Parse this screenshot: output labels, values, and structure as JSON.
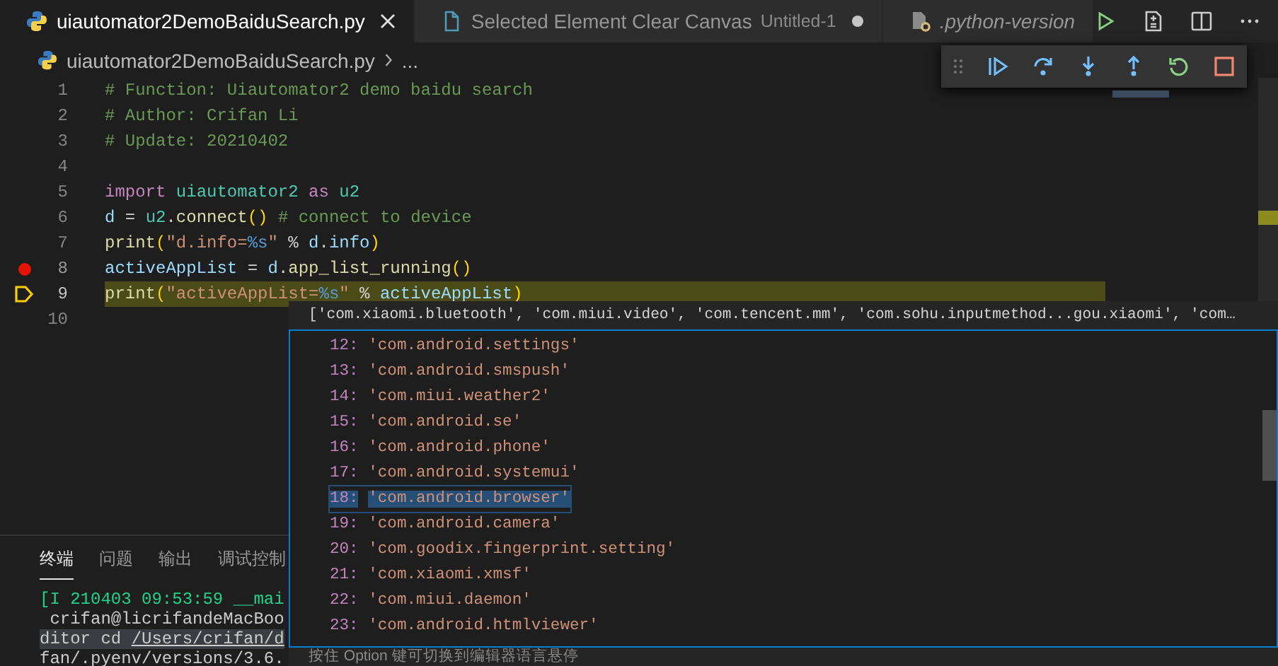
{
  "editor_tabs": [
    {
      "label": "uiautomator2DemoBaiduSearch.py",
      "selected": true,
      "dirty": false,
      "preview": false
    },
    {
      "label": "Selected Element Clear Canvas",
      "description": "Untitled-1",
      "selected": false,
      "dirty": true,
      "preview": false
    },
    {
      "label": ".python-version",
      "selected": false,
      "dirty": false,
      "preview": true
    }
  ],
  "breadcrumb": {
    "file": "uiautomator2DemoBaiduSearch.py",
    "more": "..."
  },
  "code_lines": [
    {
      "number": "1",
      "breakpoint": false,
      "current": false,
      "tokens": [
        {
          "text": "# Function: Uiautomator2 demo baidu search",
          "kind": "comment"
        }
      ]
    },
    {
      "number": "2",
      "breakpoint": false,
      "current": false,
      "tokens": [
        {
          "text": "# Author: Crifan Li",
          "kind": "comment"
        }
      ]
    },
    {
      "number": "3",
      "breakpoint": false,
      "current": false,
      "tokens": [
        {
          "text": "# Update: 20210402",
          "kind": "comment"
        }
      ]
    },
    {
      "number": "4",
      "breakpoint": false,
      "current": false
    },
    {
      "number": "5",
      "breakpoint": false,
      "current": false,
      "tokens": [
        {
          "text": "import ",
          "kind": "keyword"
        },
        {
          "text": "uiautomator2 ",
          "kind": "module"
        },
        {
          "text": "as ",
          "kind": "keyword"
        },
        {
          "text": "u2",
          "kind": "module"
        }
      ]
    },
    {
      "number": "6",
      "breakpoint": false,
      "current": false,
      "tokens": [
        {
          "text": "d",
          "kind": "variable"
        },
        {
          "text": " = ",
          "kind": "plain"
        },
        {
          "text": "u2",
          "kind": "module"
        },
        {
          "text": ".",
          "kind": "plain"
        },
        {
          "text": "connect",
          "kind": "function"
        },
        {
          "text": "()",
          "kind": "paren"
        },
        {
          "text": " # connect to device",
          "kind": "comment"
        }
      ]
    },
    {
      "number": "7",
      "breakpoint": false,
      "current": false,
      "tokens": [
        {
          "text": "print",
          "kind": "function"
        },
        {
          "text": "(",
          "kind": "paren"
        },
        {
          "text": "\"d.info=",
          "kind": "string"
        },
        {
          "text": "%s",
          "kind": "format"
        },
        {
          "text": "\"",
          "kind": "string"
        },
        {
          "text": " % ",
          "kind": "plain"
        },
        {
          "text": "d",
          "kind": "variable"
        },
        {
          "text": ".",
          "kind": "plain"
        },
        {
          "text": "info",
          "kind": "variable"
        },
        {
          "text": ")",
          "kind": "paren"
        }
      ]
    },
    {
      "number": "8",
      "breakpoint": true,
      "current": false,
      "tokens": [
        {
          "text": "activeAppList",
          "kind": "variable"
        },
        {
          "text": " = ",
          "kind": "plain"
        },
        {
          "text": "d",
          "kind": "variable"
        },
        {
          "text": ".",
          "kind": "plain"
        },
        {
          "text": "app_list_running",
          "kind": "function"
        },
        {
          "text": "()",
          "kind": "paren"
        }
      ]
    },
    {
      "number": "9",
      "breakpoint": false,
      "current": true,
      "tokens": [
        {
          "text": "print",
          "kind": "function"
        },
        {
          "text": "(",
          "kind": "paren"
        },
        {
          "text": "\"activeAppList=",
          "kind": "string"
        },
        {
          "text": "%s",
          "kind": "format"
        },
        {
          "text": "\"",
          "kind": "string"
        },
        {
          "text": " % ",
          "kind": "plain"
        },
        {
          "text": "activeAppList",
          "kind": "variable"
        },
        {
          "text": ")",
          "kind": "paren"
        }
      ]
    },
    {
      "number": "10",
      "breakpoint": false,
      "current": false
    }
  ],
  "hover": {
    "summary": "['com.xiaomi.bluetooth', 'com.miui.video', 'com.tencent.mm', 'com.sohu.inputmethod...gou.xiaomi', 'com…",
    "items": [
      {
        "index": "12:",
        "value": "'com.android.settings'",
        "selected": false
      },
      {
        "index": "13:",
        "value": "'com.android.smspush'",
        "selected": false
      },
      {
        "index": "14:",
        "value": "'com.miui.weather2'",
        "selected": false
      },
      {
        "index": "15:",
        "value": "'com.android.se'",
        "selected": false
      },
      {
        "index": "16:",
        "value": "'com.android.phone'",
        "selected": false
      },
      {
        "index": "17:",
        "value": "'com.android.systemui'",
        "selected": false
      },
      {
        "index": "18:",
        "value": "'com.android.browser'",
        "selected": true
      },
      {
        "index": "19:",
        "value": "'com.android.camera'",
        "selected": false
      },
      {
        "index": "20:",
        "value": "'com.goodix.fingerprint.setting'",
        "selected": false
      },
      {
        "index": "21:",
        "value": "'com.xiaomi.xmsf'",
        "selected": false
      },
      {
        "index": "22:",
        "value": "'com.miui.daemon'",
        "selected": false
      },
      {
        "index": "23:",
        "value": "'com.android.htmlviewer'",
        "selected": false
      }
    ],
    "hint": "按住 Option 键可切换到编辑器语言悬停"
  },
  "panel": {
    "tabs": [
      {
        "label": "终端",
        "selected": true
      },
      {
        "label": "问题",
        "selected": false
      },
      {
        "label": "输出",
        "selected": false
      },
      {
        "label": "调试控制",
        "selected": false
      }
    ],
    "terminal_lines": [
      {
        "highlighted": false,
        "segments": [
          {
            "text": "[I 210403 09:53:59 __mai",
            "kind": "info"
          }
        ]
      },
      {
        "highlighted": false,
        "segments": [
          {
            "text": " crifan@licrifandeMacBoo",
            "kind": "plain"
          }
        ]
      },
      {
        "highlighted": true,
        "segments": [
          {
            "text": "ditor cd ",
            "kind": "plain"
          },
          {
            "text": "/Users/crifan/d",
            "kind": "link"
          }
        ]
      },
      {
        "highlighted": false,
        "segments": [
          {
            "text": "fan/.pyenv/versions/3.6.",
            "kind": "plain"
          }
        ]
      }
    ]
  }
}
